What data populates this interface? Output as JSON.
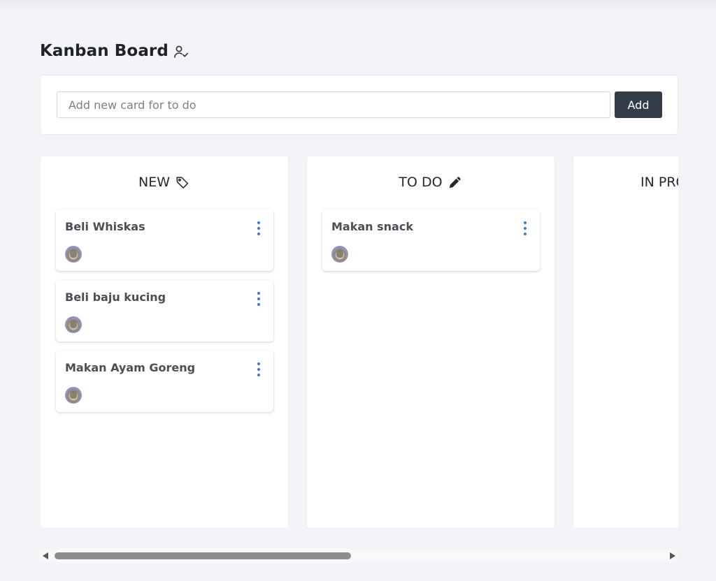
{
  "page": {
    "title": "Kanban Board",
    "title_icon": "user-check-icon"
  },
  "add_card": {
    "input_value": "",
    "input_placeholder": "Add new card for to do",
    "button_label": "Add"
  },
  "columns": [
    {
      "title": "NEW",
      "icon": "tag-icon",
      "cards": [
        {
          "title": "Beli Whiskas",
          "avatar": "cat-avatar"
        },
        {
          "title": "Beli baju kucing",
          "avatar": "cat-avatar"
        },
        {
          "title": "Makan Ayam Goreng",
          "avatar": "cat-avatar"
        }
      ]
    },
    {
      "title": "TO DO",
      "icon": "pencil-icon",
      "cards": [
        {
          "title": "Makan snack",
          "avatar": "cat-avatar"
        }
      ]
    },
    {
      "title": "IN PRO",
      "cards": []
    }
  ],
  "colors": {
    "background": "#f3f4f7",
    "add_button": "#323d49",
    "menu_dots": "#3a7ac8",
    "scroll_thumb": "#8d8d8d"
  }
}
